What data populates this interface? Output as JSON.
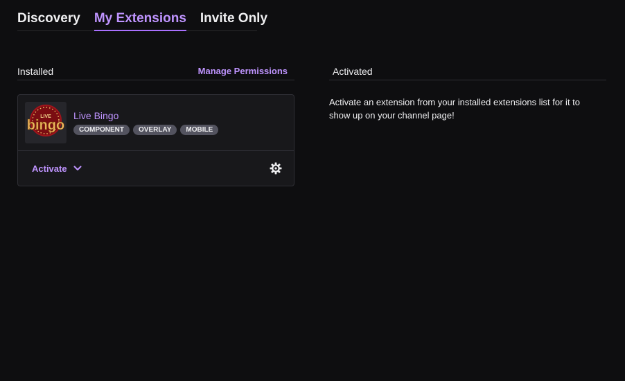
{
  "tabs": [
    {
      "label": "Discovery",
      "active": false
    },
    {
      "label": "My Extensions",
      "active": true
    },
    {
      "label": "Invite Only",
      "active": false
    }
  ],
  "installed": {
    "title": "Installed",
    "manage_label": "Manage Permissions",
    "extensions": [
      {
        "name": "Live Bingo",
        "logo_text_top": "LIVE",
        "logo_text_main": "bingo",
        "tags": [
          "COMPONENT",
          "OVERLAY",
          "MOBILE"
        ],
        "activate_label": "Activate"
      }
    ]
  },
  "activated": {
    "title": "Activated",
    "message": "Activate an extension from your installed extensions list for it to show up on your channel page!"
  },
  "colors": {
    "background": "#0e0e10",
    "accent": "#bf94ff",
    "card": "#18181b",
    "tag_bg": "#53535f"
  },
  "icons": {
    "dropdown": "chevron-down-icon",
    "settings": "gear-icon"
  }
}
